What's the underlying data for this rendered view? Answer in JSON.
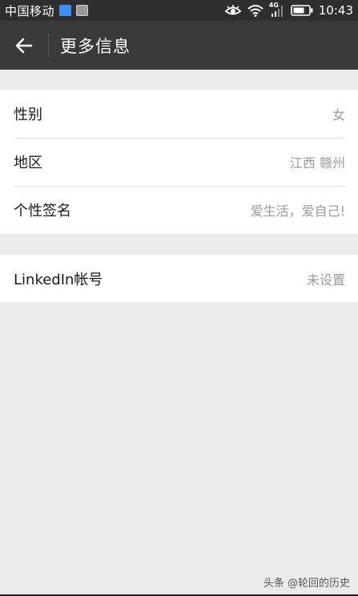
{
  "status_bar": {
    "carrier": "中国移动",
    "network": "4G",
    "time": "10:43"
  },
  "header": {
    "title": "更多信息",
    "back_icon": "arrow-left-icon"
  },
  "group1": {
    "items": [
      {
        "label": "性别",
        "value": "女"
      },
      {
        "label": "地区",
        "value": "江西 赣州"
      },
      {
        "label": "个性签名",
        "value": "爱生活，爱自己!"
      }
    ]
  },
  "group2": {
    "items": [
      {
        "label": "LinkedIn帐号",
        "value": "未设置"
      }
    ]
  },
  "watermark": "头条 @轮回的历史"
}
